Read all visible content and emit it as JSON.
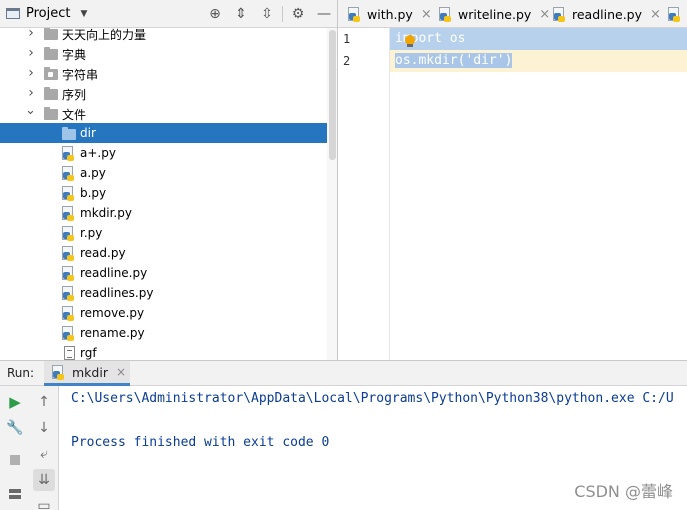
{
  "project_panel": {
    "title": "Project",
    "tree": [
      {
        "label": "天天向上的力量",
        "kind": "folder",
        "depth": 1,
        "expanded": false,
        "selected": false
      },
      {
        "label": "字典",
        "kind": "folder",
        "depth": 1,
        "expanded": false,
        "selected": false
      },
      {
        "label": "字符串",
        "kind": "package",
        "depth": 1,
        "expanded": false,
        "selected": false
      },
      {
        "label": "序列",
        "kind": "folder",
        "depth": 1,
        "expanded": false,
        "selected": false
      },
      {
        "label": "文件",
        "kind": "folder",
        "depth": 1,
        "expanded": true,
        "selected": false
      },
      {
        "label": "dir",
        "kind": "folder",
        "depth": 2,
        "expanded": null,
        "selected": true
      },
      {
        "label": "a+.py",
        "kind": "python",
        "depth": 2,
        "selected": false
      },
      {
        "label": "a.py",
        "kind": "python",
        "depth": 2,
        "selected": false
      },
      {
        "label": "b.py",
        "kind": "python",
        "depth": 2,
        "selected": false
      },
      {
        "label": "mkdir.py",
        "kind": "python",
        "depth": 2,
        "selected": false
      },
      {
        "label": "r.py",
        "kind": "python",
        "depth": 2,
        "selected": false
      },
      {
        "label": "read.py",
        "kind": "python",
        "depth": 2,
        "selected": false
      },
      {
        "label": "readline.py",
        "kind": "python",
        "depth": 2,
        "selected": false
      },
      {
        "label": "readlines.py",
        "kind": "python",
        "depth": 2,
        "selected": false
      },
      {
        "label": "remove.py",
        "kind": "python",
        "depth": 2,
        "selected": false
      },
      {
        "label": "rename.py",
        "kind": "python",
        "depth": 2,
        "selected": false
      },
      {
        "label": "rgf",
        "kind": "text",
        "depth": 2,
        "selected": false
      }
    ]
  },
  "editor": {
    "tabs": [
      {
        "label": "with.py",
        "close": "×"
      },
      {
        "label": "writeline.py",
        "close": "×"
      },
      {
        "label": "readline.py",
        "close": "×"
      },
      {
        "label": "s",
        "close": ""
      }
    ],
    "lines": [
      {
        "number": "1",
        "keyword": "import",
        "rest": " os"
      },
      {
        "number": "2",
        "keyword": "",
        "rest": "os.mkdir('dir')"
      }
    ]
  },
  "run_panel": {
    "label": "Run:",
    "tab_label": "mkdir",
    "tab_close": "×",
    "console_lines": [
      "C:\\Users\\Administrator\\AppData\\Local\\Programs\\Python\\Python38\\python.exe C:/U",
      "Process finished with exit code 0"
    ]
  },
  "watermark": "CSDN @蕾峰",
  "colors": {
    "selection": "#2675bf",
    "console_text": "#0a3c96",
    "current_line": "#fcf3d4",
    "code_selection": "#b7d0eb"
  }
}
